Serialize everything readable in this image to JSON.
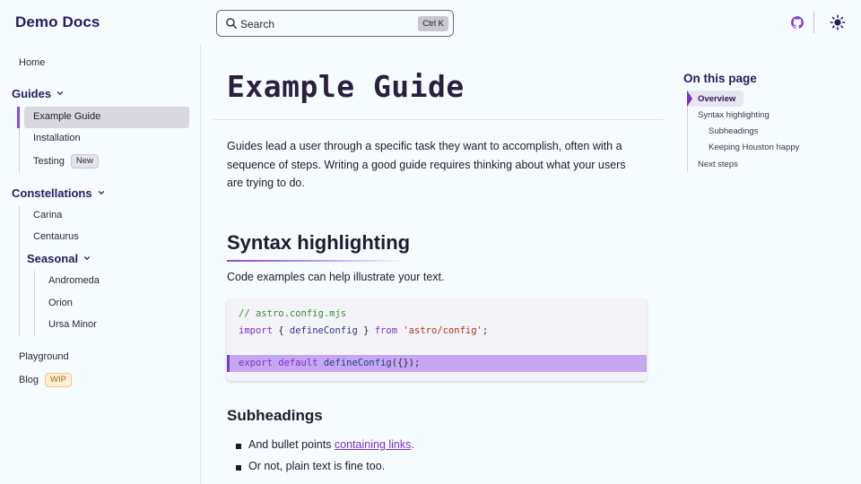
{
  "header": {
    "site_title": "Demo Docs",
    "search_placeholder": "Search",
    "search_shortcut": "Ctrl K",
    "icons": [
      "search-icon",
      "github-icon",
      "sun-icon"
    ]
  },
  "sidebar": {
    "home": "Home",
    "guides": {
      "label": "Guides",
      "items": [
        {
          "label": "Example Guide",
          "active": true
        },
        {
          "label": "Installation"
        },
        {
          "label": "Testing",
          "badge": "New"
        }
      ]
    },
    "constellations": {
      "label": "Constellations",
      "items": [
        "Carina",
        "Centaurus"
      ],
      "seasonal": {
        "label": "Seasonal",
        "items": [
          "Andromeda",
          "Orion",
          "Ursa Minor"
        ]
      }
    },
    "playground": "Playground",
    "blog": {
      "label": "Blog",
      "badge": "WIP"
    }
  },
  "main": {
    "title": "Example Guide",
    "intro": "Guides lead a user through a specific task they want to accomplish, often with a sequence of steps. Writing a good guide requires thinking about what your users are trying to do.",
    "h2": "Syntax highlighting",
    "h2_text": "Code examples can help illustrate your text.",
    "code": {
      "line1": "// astro.config.mjs",
      "line2_kw": "import",
      "line2_open": " { ",
      "line2_fn": "defineConfig",
      "line2_close": " } ",
      "line2_from": "from",
      "line2_str": "'astro/config'",
      "line2_end": ";",
      "line4_kw1": "export",
      "line4_kw2": "default",
      "line4_fn": "defineConfig",
      "line4_end": "({});"
    },
    "h3": "Subheadings",
    "bullet1_text": "And bullet points ",
    "bullet1_link": "containing links",
    "bullet1_end": ".",
    "bullet2": "Or not, plain text is fine too."
  },
  "toc": {
    "title": "On this page",
    "items": [
      {
        "label": "Overview",
        "active": true
      },
      {
        "label": "Syntax highlighting"
      },
      {
        "label": "Subheadings"
      },
      {
        "label": "Keeping Houston happy"
      },
      {
        "label": "Next steps"
      }
    ]
  },
  "colors": {
    "accent": "#7d2fc7",
    "accent_bar": "#8a4ed3",
    "highlight": "#c5a7f2",
    "title": "#2a1a5e"
  }
}
